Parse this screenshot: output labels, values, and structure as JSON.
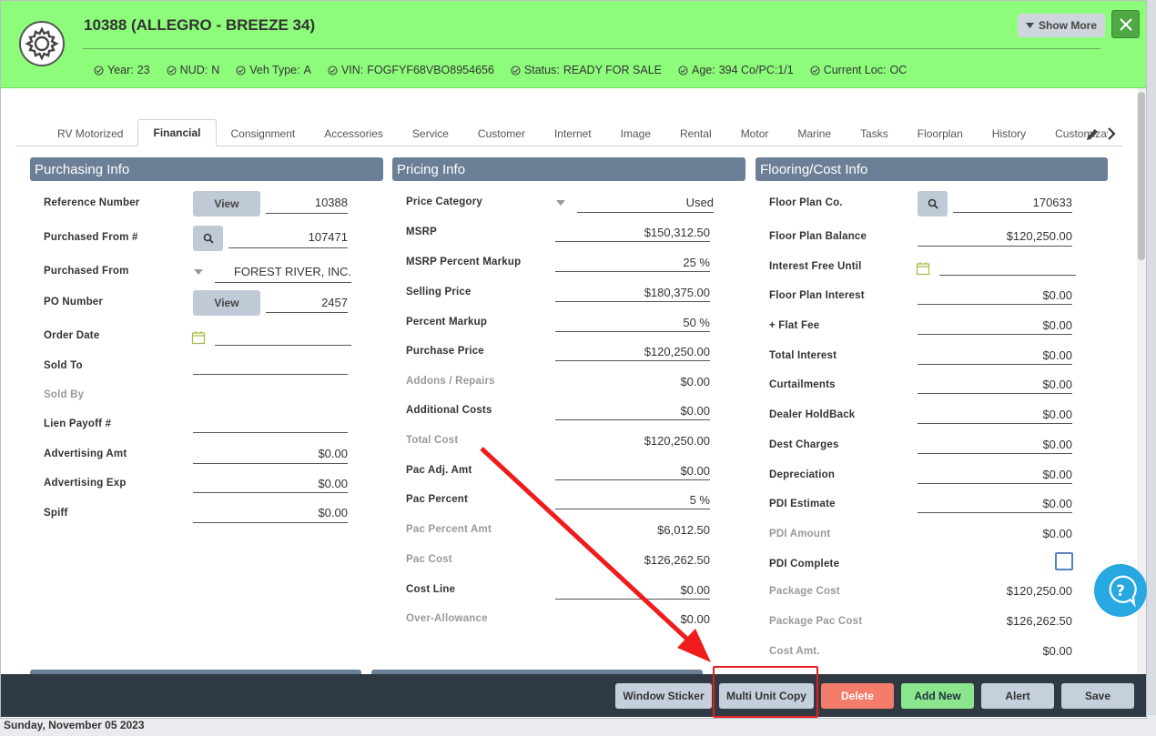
{
  "header": {
    "title": "10388 (ALLEGRO - BREEZE 34)",
    "show_more": "Show More",
    "meta": [
      {
        "label": "Year:",
        "value": "23"
      },
      {
        "label": "NUD:",
        "value": "N"
      },
      {
        "label": "Veh Type:",
        "value": "A"
      },
      {
        "label": "VIN:",
        "value": "FOGFYF68VBO8954656"
      },
      {
        "label": "Status:",
        "value": "READY FOR SALE"
      },
      {
        "label": "Age:",
        "value": "394  Co/PC:1/1"
      },
      {
        "label": "Current Loc:",
        "value": "OC"
      }
    ],
    "accent": "#8cfc7a"
  },
  "tabs": [
    "RV Motorized",
    "Financial",
    "Consignment",
    "Accessories",
    "Service",
    "Customer",
    "Internet",
    "Image",
    "Rental",
    "Motor",
    "Marine",
    "Tasks",
    "Floorplan",
    "History",
    "Customization"
  ],
  "active_tab": "Financial",
  "purchasing": {
    "title": "Purchasing Info",
    "reference_number": {
      "label": "Reference Number",
      "button": "View",
      "value": "10388"
    },
    "purchased_from_num": {
      "label": "Purchased From #",
      "value": "107471"
    },
    "purchased_from": {
      "label": "Purchased From",
      "value": "FOREST RIVER, INC."
    },
    "po_number": {
      "label": "PO Number",
      "button": "View",
      "value": "2457"
    },
    "order_date": {
      "label": "Order Date",
      "value": ""
    },
    "sold_to": {
      "label": "Sold To",
      "value": ""
    },
    "sold_by": {
      "label": "Sold By",
      "value": ""
    },
    "lien_payoff": {
      "label": "Lien Payoff #",
      "value": ""
    },
    "advertising_amt": {
      "label": "Advertising Amt",
      "value": "$0.00"
    },
    "advertising_exp": {
      "label": "Advertising Exp",
      "value": "$0.00"
    },
    "spiff": {
      "label": "Spiff",
      "value": "$0.00"
    }
  },
  "pricing": {
    "title": "Pricing Info",
    "price_category": {
      "label": "Price Category",
      "value": "Used"
    },
    "rows": [
      {
        "label": "MSRP",
        "value": "$150,312.50",
        "muted": false,
        "underline": true
      },
      {
        "label": "MSRP Percent Markup",
        "value": "25 %",
        "muted": false,
        "underline": true
      },
      {
        "label": "Selling Price",
        "value": "$180,375.00",
        "muted": false,
        "underline": true
      },
      {
        "label": "Percent Markup",
        "value": "50 %",
        "muted": false,
        "underline": true
      },
      {
        "label": "Purchase Price",
        "value": "$120,250.00",
        "muted": false,
        "underline": true
      },
      {
        "label": "Addons / Repairs",
        "value": "$0.00",
        "muted": true,
        "underline": false
      },
      {
        "label": "Additional Costs",
        "value": "$0.00",
        "muted": false,
        "underline": true
      },
      {
        "label": "Total Cost",
        "value": "$120,250.00",
        "muted": true,
        "underline": false
      },
      {
        "label": "Pac Adj. Amt",
        "value": "$0.00",
        "muted": false,
        "underline": true
      },
      {
        "label": "Pac Percent",
        "value": "5 %",
        "muted": false,
        "underline": true
      },
      {
        "label": "Pac Percent Amt",
        "value": "$6,012.50",
        "muted": true,
        "underline": false
      },
      {
        "label": "Pac Cost",
        "value": "$126,262.50",
        "muted": true,
        "underline": false
      },
      {
        "label": "Cost Line",
        "value": "$0.00",
        "muted": false,
        "underline": true
      },
      {
        "label": "Over-Allowance",
        "value": "$0.00",
        "muted": true,
        "underline": false
      }
    ]
  },
  "flooring": {
    "title": "Flooring/Cost Info",
    "floor_plan_co": {
      "label": "Floor Plan Co.",
      "value": "170633"
    },
    "floor_plan_balance": {
      "label": "Floor Plan Balance",
      "value": "$120,250.00"
    },
    "interest_free_until": {
      "label": "Interest Free Until",
      "value": ""
    },
    "rows": [
      {
        "label": "Floor Plan Interest",
        "value": "$0.00",
        "muted": false,
        "underline": true
      },
      {
        "label": "+ Flat Fee",
        "value": "$0.00",
        "muted": false,
        "underline": true
      },
      {
        "label": "Total Interest",
        "value": "$0.00",
        "muted": false,
        "underline": true
      },
      {
        "label": "Curtailments",
        "value": "$0.00",
        "muted": false,
        "underline": true
      },
      {
        "label": "Dealer HoldBack",
        "value": "$0.00",
        "muted": false,
        "underline": true
      },
      {
        "label": "Dest Charges",
        "value": "$0.00",
        "muted": false,
        "underline": true
      },
      {
        "label": "Depreciation",
        "value": "$0.00",
        "muted": false,
        "underline": true
      },
      {
        "label": "PDI Estimate",
        "value": "$0.00",
        "muted": false,
        "underline": true
      },
      {
        "label": "PDI Amount",
        "value": "$0.00",
        "muted": true,
        "underline": false
      }
    ],
    "pdi_complete": {
      "label": "PDI Complete",
      "checked": false
    },
    "rows2": [
      {
        "label": "Package Cost",
        "value": "$120,250.00"
      },
      {
        "label": "Package Pac Cost",
        "value": "$126,262.50"
      },
      {
        "label": "Cost Amt.",
        "value": "$0.00"
      }
    ]
  },
  "footer": {
    "buttons": [
      {
        "label": "Window Sticker"
      },
      {
        "label": "Multi Unit Copy"
      },
      {
        "label": "Delete"
      },
      {
        "label": "Add New"
      },
      {
        "label": "Alert"
      },
      {
        "label": "Save"
      }
    ],
    "date": "Sunday, November 05 2023"
  },
  "icons": {
    "gear": "gear-icon",
    "close": "close-icon",
    "check": "check-circle-icon",
    "search": "search-icon",
    "calendar": "calendar-icon",
    "help": "help-chat-icon",
    "pencil": "pencil-icon",
    "chevron": "chevron-right-icon"
  }
}
